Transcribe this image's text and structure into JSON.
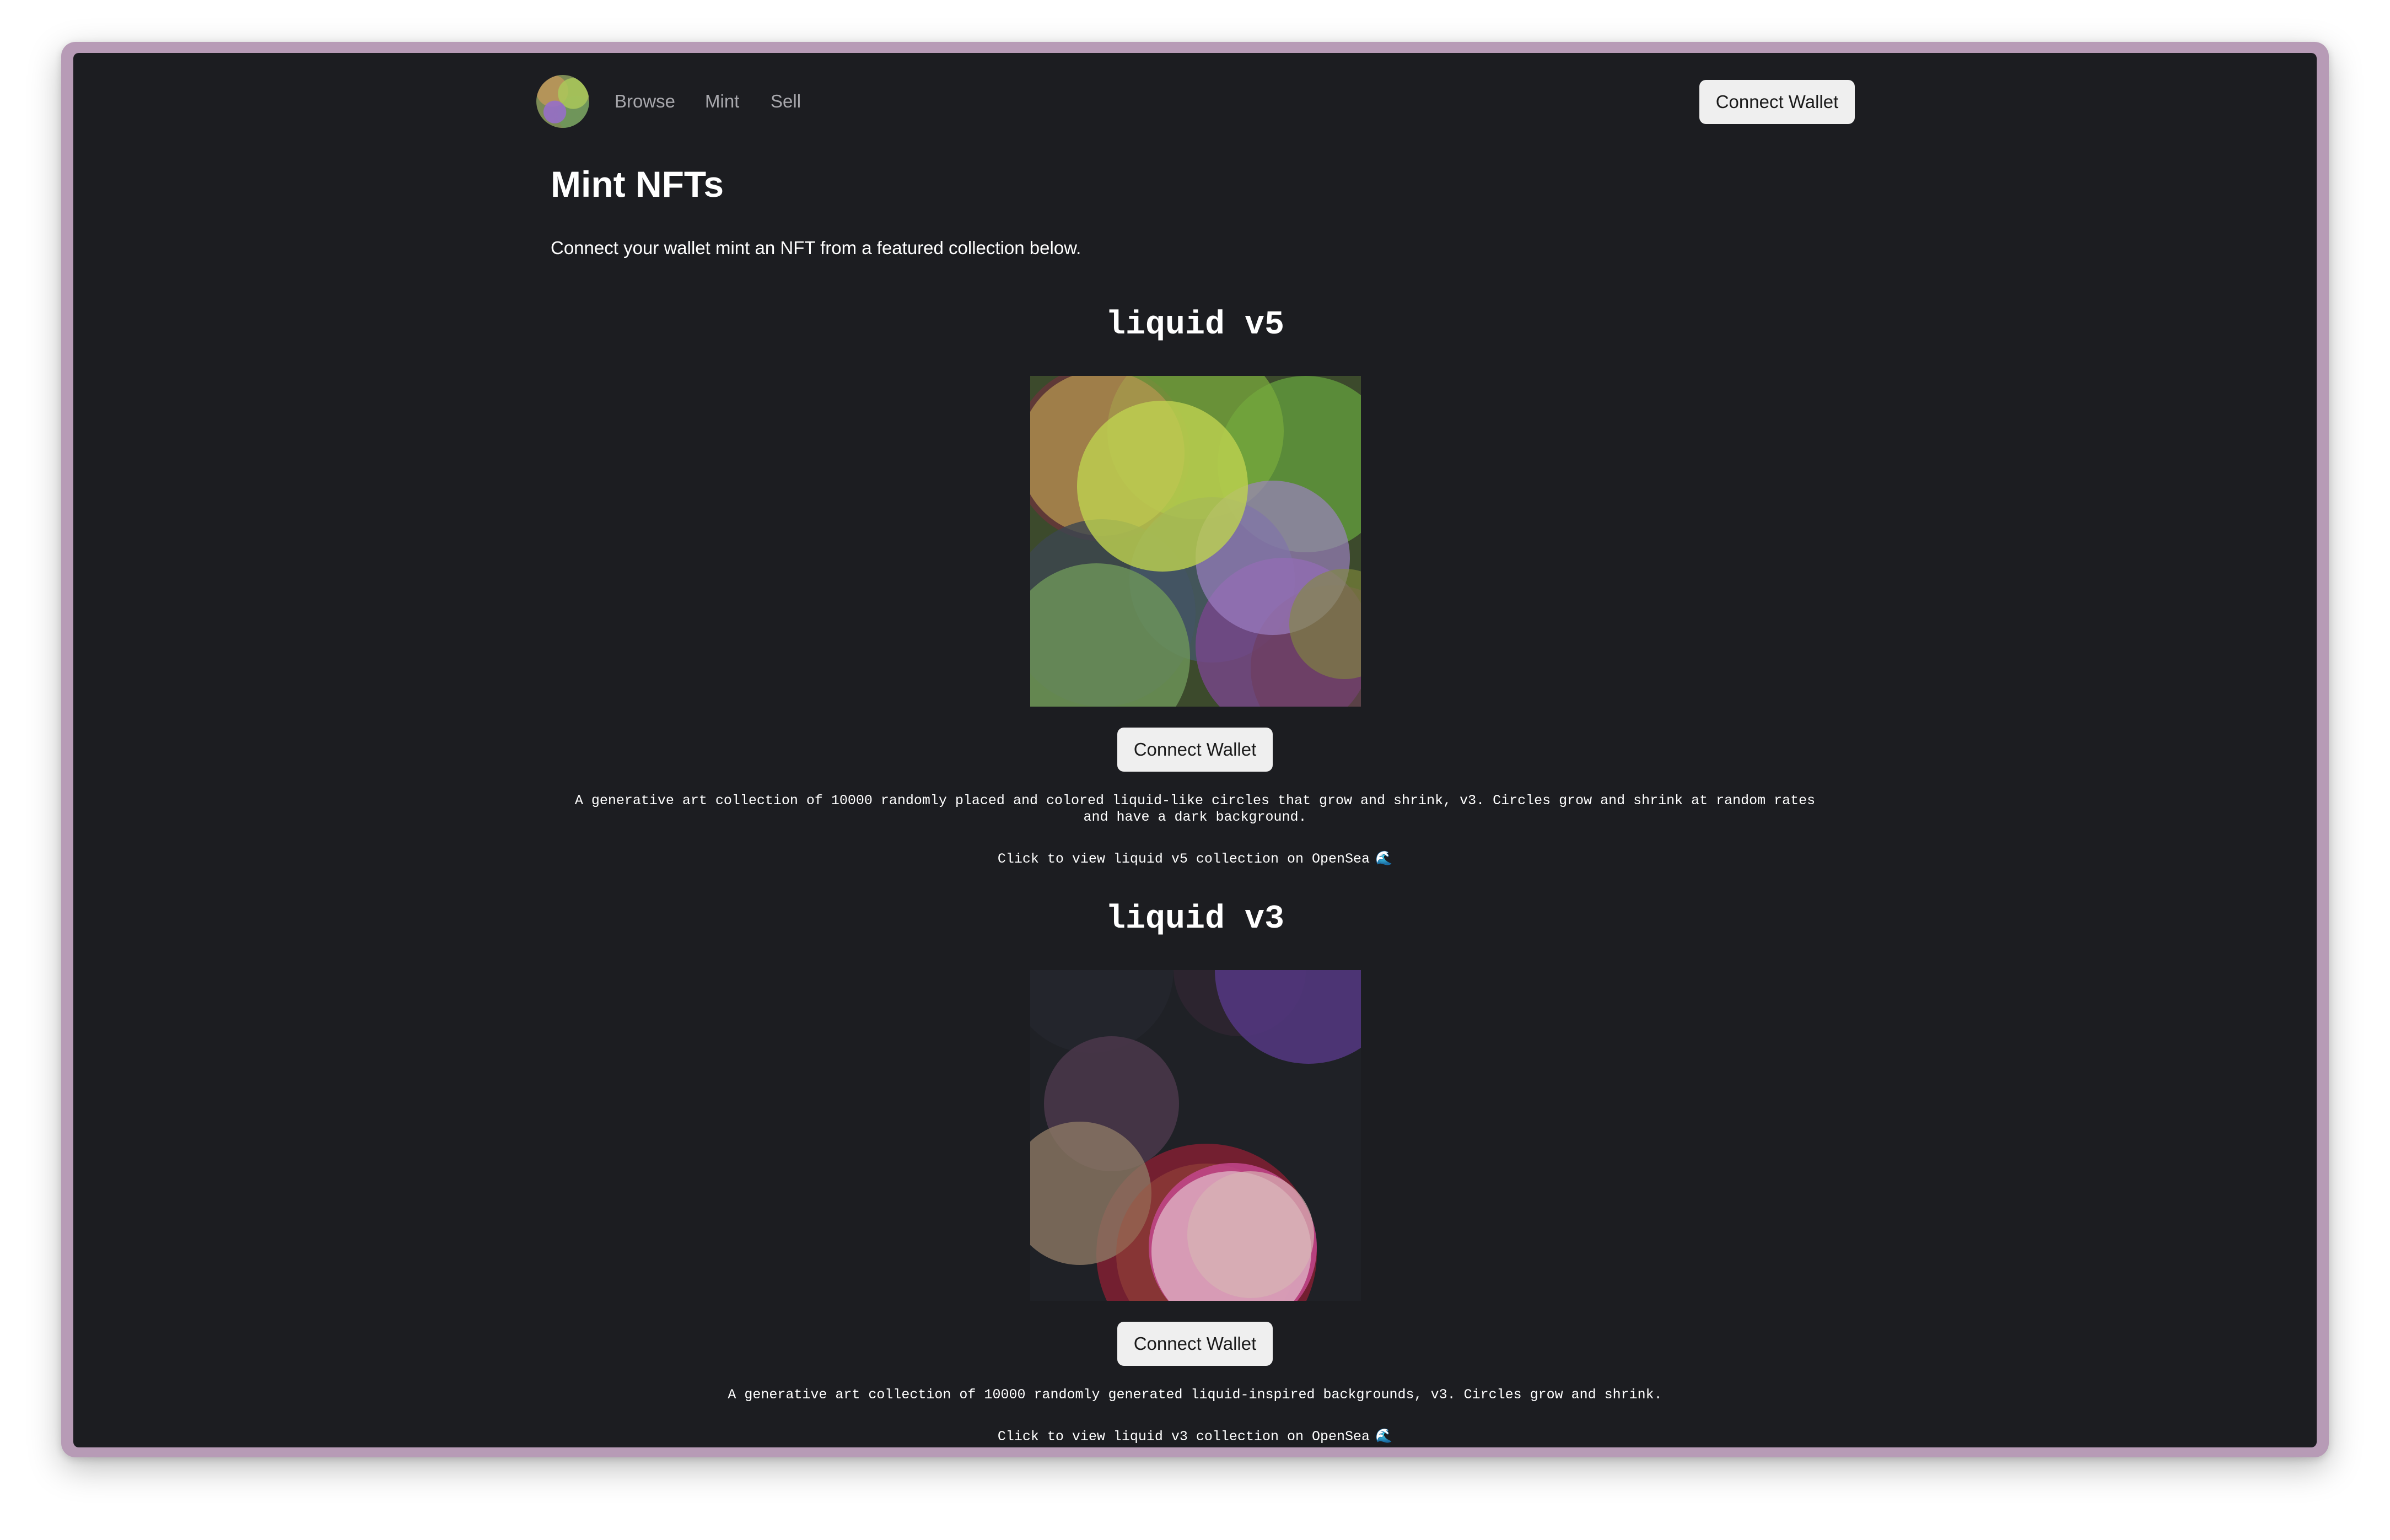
{
  "nav": {
    "links": [
      "Browse",
      "Mint",
      "Sell"
    ],
    "connect_label": "Connect Wallet"
  },
  "page": {
    "title": "Mint NFTs",
    "subtitle": "Connect your wallet mint an NFT from a featured collection below."
  },
  "collections": [
    {
      "name": "liquid v5",
      "button_label": "Connect Wallet",
      "description": "A generative art collection of 10000 randomly placed and colored liquid-like circles that grow and shrink, v3. Circles grow and shrink at random rates and have a dark background.",
      "link_text": "Click to view liquid v5 collection on OpenSea",
      "link_icon": "🌊"
    },
    {
      "name": "liquid v3",
      "button_label": "Connect Wallet",
      "description": "A generative art collection of 10000 randomly generated liquid-inspired backgrounds, v3. Circles grow and shrink.",
      "link_text": "Click to view liquid v3 collection on OpenSea",
      "link_icon": "🌊"
    }
  ],
  "colors": {
    "background": "#1c1d21",
    "frame": "#b79bb6",
    "button_bg": "#efefef",
    "nav_text": "#a8a8ad"
  }
}
